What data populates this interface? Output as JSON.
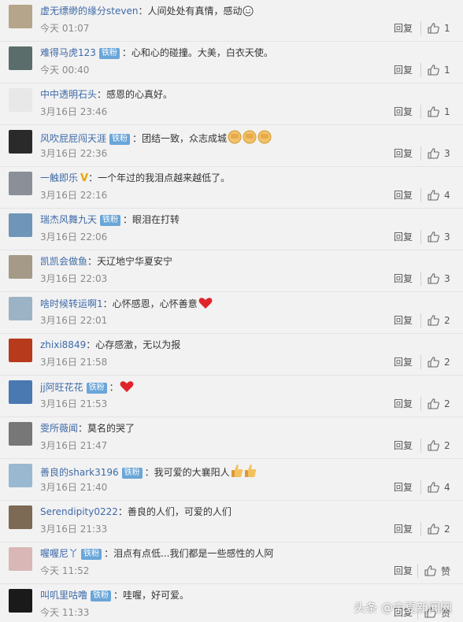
{
  "comments": [
    {
      "user": "虚无缥缈的缘分steven",
      "badge": "",
      "vmark": false,
      "text": "人间处处有真情，感动",
      "emoji": "smile",
      "time": "今天 01:07",
      "reply": "回复",
      "likes": "1",
      "avatar_color": "#b5a58a"
    },
    {
      "user": "难得马虎123",
      "badge": "铁粉",
      "vmark": false,
      "text": "心和心的碰撞。大美，白衣天使。",
      "emoji": "",
      "time": "今天 00:40",
      "reply": "回复",
      "likes": "1",
      "avatar_color": "#5a6d6a"
    },
    {
      "user": "中中透明石头",
      "badge": "",
      "vmark": false,
      "text": "感恩的心真好。",
      "emoji": "",
      "time": "3月16日 23:46",
      "reply": "回复",
      "likes": "1",
      "avatar_color": "#e8e8e8"
    },
    {
      "user": "风吹屁屁闯天涯",
      "badge": "铁粉",
      "vmark": false,
      "text": "团结一致，众志成城",
      "emoji": "fist3",
      "time": "3月16日 22:36",
      "reply": "回复",
      "likes": "3",
      "avatar_color": "#2a2a2a"
    },
    {
      "user": "一触即乐",
      "badge": "",
      "vmark": true,
      "text": "一个年过的我泪点越来越低了。",
      "emoji": "",
      "time": "3月16日 22:16",
      "reply": "回复",
      "likes": "4",
      "avatar_color": "#8a8f98"
    },
    {
      "user": "瑞杰风舞九天",
      "badge": "铁粉",
      "vmark": false,
      "text": "眼泪在打转",
      "emoji": "",
      "time": "3月16日 22:06",
      "reply": "回复",
      "likes": "3",
      "avatar_color": "#6f95b8"
    },
    {
      "user": "凯凯会做鱼",
      "badge": "",
      "vmark": false,
      "text": "天辽地宁华夏安宁",
      "emoji": "",
      "time": "3月16日 22:03",
      "reply": "回复",
      "likes": "3",
      "avatar_color": "#a59a88"
    },
    {
      "user": "啥时候转运啊1",
      "badge": "",
      "vmark": false,
      "text": "心怀感恩，心怀善意",
      "emoji": "heart",
      "time": "3月16日 22:01",
      "reply": "回复",
      "likes": "2",
      "avatar_color": "#9bb3c4"
    },
    {
      "user": "zhixi8849",
      "badge": "",
      "vmark": false,
      "text": "心存感激，无以为报",
      "emoji": "",
      "time": "3月16日 21:58",
      "reply": "回复",
      "likes": "2",
      "avatar_color": "#b83a1c"
    },
    {
      "user": "jj阿旺花花",
      "badge": "铁粉",
      "vmark": false,
      "text": "",
      "emoji": "heart",
      "time": "3月16日 21:53",
      "reply": "回复",
      "likes": "2",
      "avatar_color": "#4a78b0"
    },
    {
      "user": "雯所薇闻",
      "badge": "",
      "vmark": false,
      "text": "莫名的哭了",
      "emoji": "",
      "time": "3月16日 21:47",
      "reply": "回复",
      "likes": "2",
      "avatar_color": "#777"
    },
    {
      "user": "善良的shark3196",
      "badge": "铁粉",
      "vmark": false,
      "text": "我可爱的大襄阳人",
      "emoji": "thumb2",
      "time": "3月16日 21:40",
      "reply": "回复",
      "likes": "4",
      "avatar_color": "#9ab8d0"
    },
    {
      "user": "Serendipity0222",
      "badge": "",
      "vmark": false,
      "text": "善良的人们，可爱的人们",
      "emoji": "",
      "time": "3月16日 21:33",
      "reply": "回复",
      "likes": "2",
      "avatar_color": "#7c6a55"
    },
    {
      "user": "喔喔尼丫",
      "badge": "铁粉",
      "vmark": false,
      "text": "泪点有点低...我们都是一些感性的人阿",
      "emoji": "",
      "time": "今天 11:52",
      "reply": "回复",
      "likes": "赞",
      "avatar_color": "#d9b7b7"
    },
    {
      "user": "叫叽里咕噜",
      "badge": "铁粉",
      "vmark": false,
      "text": "哇喔，好可爱。",
      "emoji": "",
      "time": "今天 11:33",
      "reply": "回复",
      "likes": "赞",
      "avatar_color": "#1a1a1a"
    }
  ],
  "watermark": "头条 @宁夏新闻网",
  "colors": {
    "username": "#3e6aa8",
    "badge": "#6aa6d8",
    "heart": "#e0242a"
  }
}
